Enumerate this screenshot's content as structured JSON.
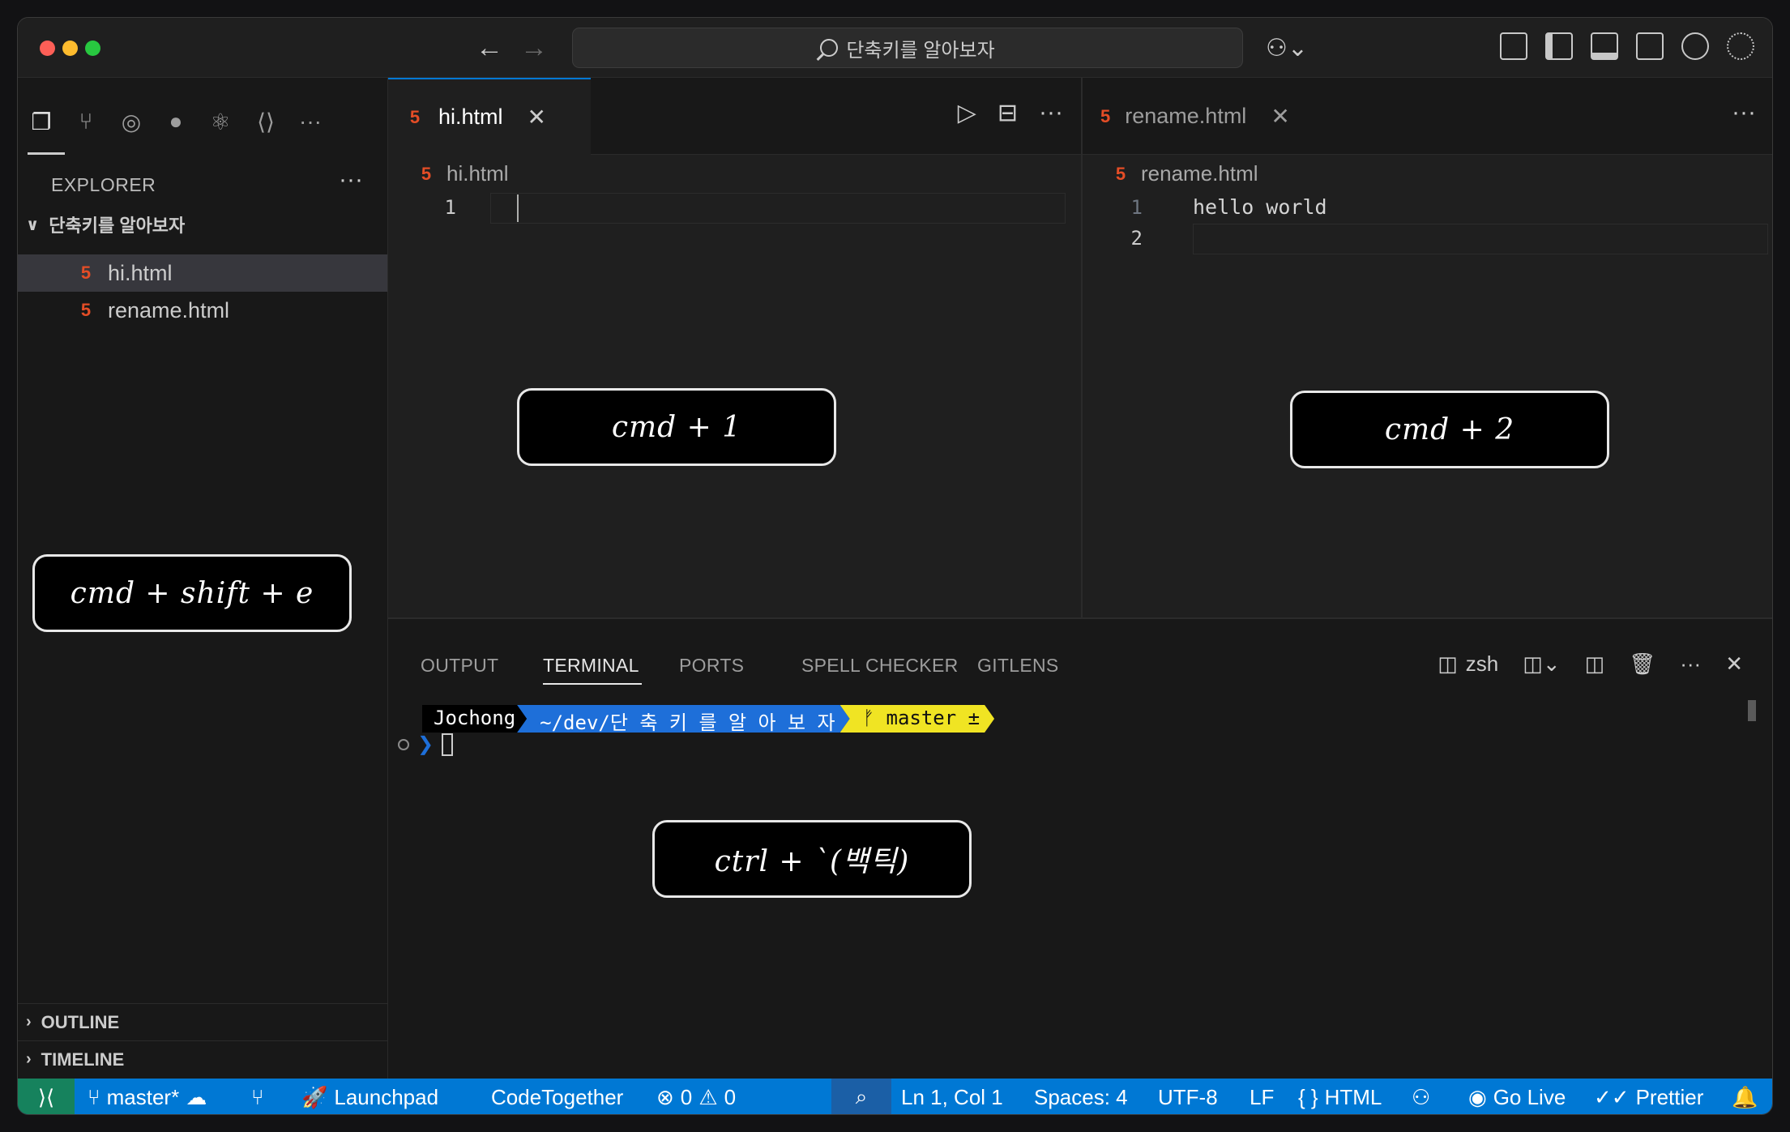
{
  "titlebar": {
    "search_text": "단축키를 알아보자"
  },
  "explorer": {
    "title": "EXPLORER",
    "more": "···",
    "folder": "단축키를 알아보자",
    "files": [
      {
        "name": "hi.html",
        "active": true
      },
      {
        "name": "rename.html",
        "active": false
      }
    ],
    "sections": [
      "OUTLINE",
      "TIMELINE"
    ]
  },
  "editor1": {
    "tab": "hi.html",
    "breadcrumb": "hi.html",
    "lines": [
      {
        "no": "1",
        "text": ""
      }
    ]
  },
  "editor2": {
    "tab": "rename.html",
    "breadcrumb": "rename.html",
    "lines": [
      {
        "no": "1",
        "text": "hello world"
      },
      {
        "no": "2",
        "text": ""
      }
    ]
  },
  "panel": {
    "tabs": [
      "OUTPUT",
      "TERMINAL",
      "PORTS",
      "SPELL CHECKER",
      "GITLENS"
    ],
    "active_tab": "TERMINAL",
    "shell": "zsh",
    "prompt": {
      "user": "Jochong",
      "path": "~/dev/단 축 키 를  알 아 보 자",
      "git": "ᚠ master ±"
    }
  },
  "shortcuts": {
    "explorer": "cmd + shift + e",
    "editor1": "cmd + 1",
    "editor2": "cmd + 2",
    "terminal": "ctrl + `(백틱)"
  },
  "statusbar": {
    "branch": "master*",
    "launchpad": "Launchpad",
    "codetogether": "CodeTogether",
    "errors": "0",
    "warnings": "0",
    "position": "Ln 1, Col 1",
    "spaces": "Spaces: 4",
    "encoding": "UTF-8",
    "eol": "LF",
    "language": "HTML",
    "golive": "Go Live",
    "prettier": "Prettier"
  },
  "colors": {
    "accent": "#0078d4",
    "remote": "#16825d",
    "html_icon": "#e44d26",
    "git_segment": "#f0e423",
    "path_segment": "#1e6fd9"
  }
}
